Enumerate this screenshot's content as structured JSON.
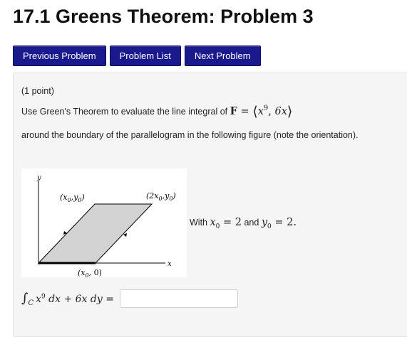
{
  "header": {
    "title": "17.1 Greens Theorem: Problem 3"
  },
  "nav": {
    "previous_label": "Previous Problem",
    "list_label": "Problem List",
    "next_label": "Next Problem"
  },
  "problem": {
    "points": "(1 point)",
    "statement_intro": "Use Green's Theorem to evaluate the line integral of",
    "vector_symbol": "F",
    "vector_eq": " = ",
    "vector_first": "x",
    "vector_first_exp": "9",
    "vector_second": "6x",
    "statement_cont": "around the boundary of the parallelogram in the following figure (note the orientation).",
    "with_prefix": "With ",
    "x0_expr": "x",
    "x0_sub": "0",
    "x0_value": " = 2",
    "and_text": " and ",
    "y0_expr": "y",
    "y0_sub": "0",
    "y0_value": " = 2.",
    "figure": {
      "y_axis_label": "y",
      "x_axis_label": "x",
      "top_left_label": "(x",
      "top_left_label_mid": ",y",
      "top_right_label": "(2x",
      "top_right_label_mid": ",y",
      "bottom_label": "(x",
      "bottom_label_end": ", 0)",
      "sub": "0",
      "parallelogram_fill": "#d3d3d3"
    }
  },
  "answer": {
    "integral_sign": "∫",
    "contour": "C",
    "term1": "x",
    "term1_exp": "9",
    "term1_d": " dx + 6x dy = ",
    "input_value": ""
  },
  "colors": {
    "nav_bg": "#1a1a8c",
    "box_bg": "#f5f5f5"
  }
}
